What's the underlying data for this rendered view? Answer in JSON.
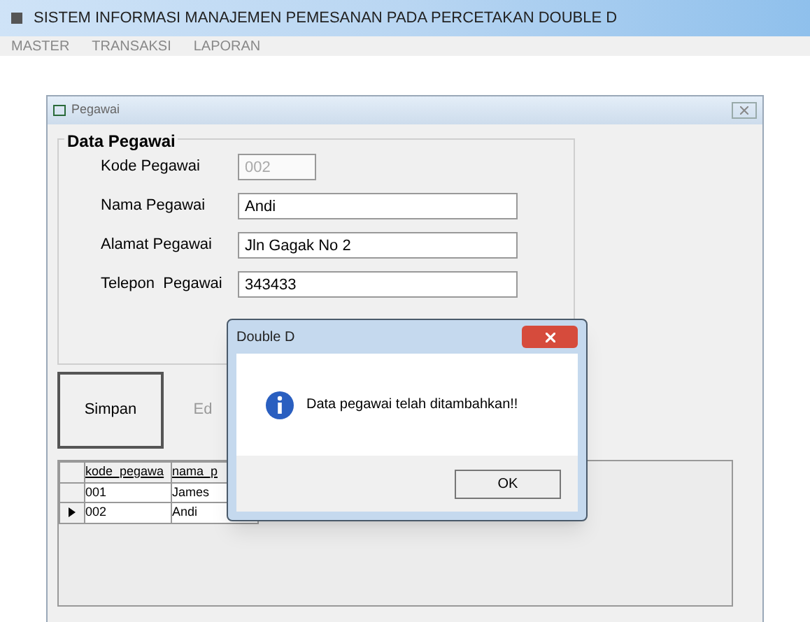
{
  "window": {
    "title": "SISTEM INFORMASI MANAJEMEN PEMESANAN PADA PERCETAKAN DOUBLE D"
  },
  "menu": [
    {
      "label": "MASTER"
    },
    {
      "label": "TRANSAKSI"
    },
    {
      "label": "LAPORAN"
    }
  ],
  "form": {
    "title": "Pegawai",
    "group_title": "Data Pegawai",
    "fields": [
      {
        "label": "Kode Pegawai",
        "value": "002",
        "disabled": true
      },
      {
        "label": "Nama Pegawai",
        "value": "Andi",
        "disabled": false
      },
      {
        "label": "Alamat Pegawai",
        "value": "Jln Gagak No 2",
        "disabled": false
      },
      {
        "label": "Telepon  Pegawai",
        "value": "343433",
        "disabled": false
      }
    ],
    "buttons": [
      {
        "label": "Simpan",
        "disabled": false
      },
      {
        "label": "Ed",
        "disabled": true
      }
    ],
    "table": {
      "columns": [
        "kode_pegawa",
        "nama_p"
      ],
      "rows": [
        {
          "cells": [
            "001",
            "James"
          ],
          "selected": false
        },
        {
          "cells": [
            "002",
            "Andi"
          ],
          "selected": true
        }
      ]
    }
  },
  "dialog": {
    "title": "Double D",
    "message": "Data pegawai telah ditambahkan!!",
    "button": "OK"
  }
}
